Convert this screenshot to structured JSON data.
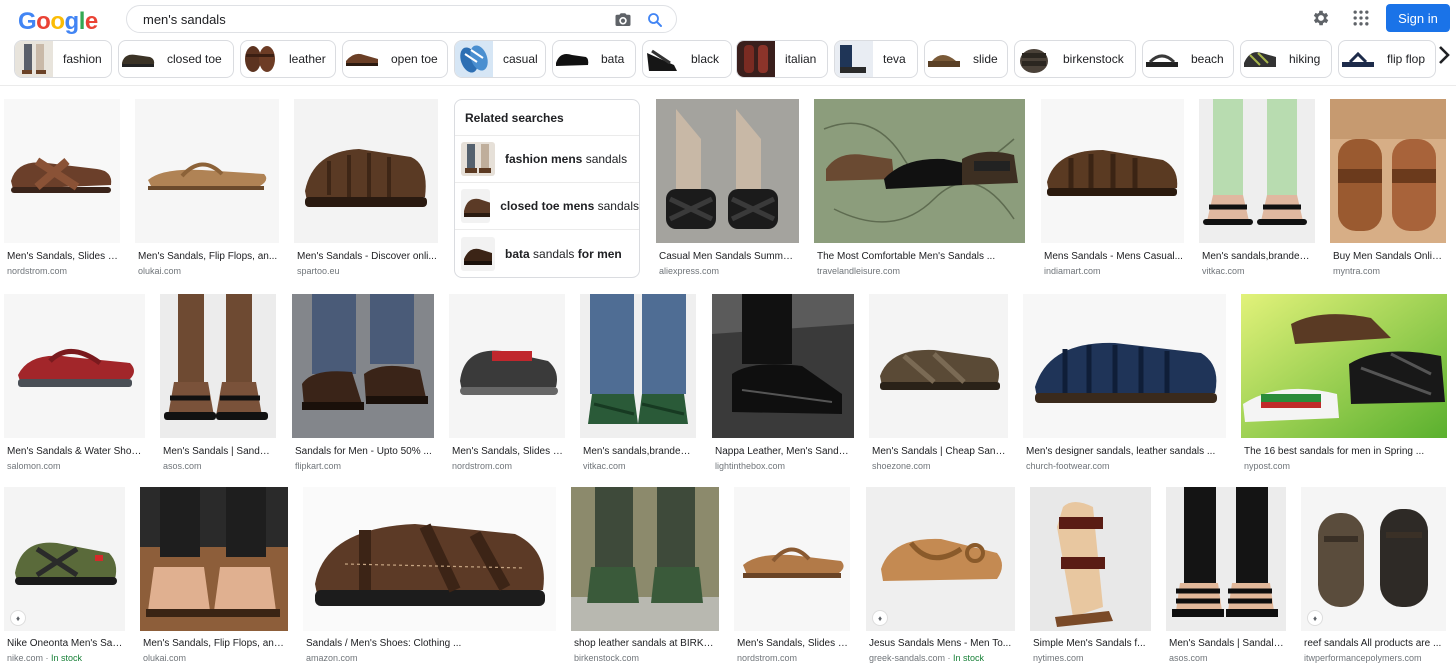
{
  "logo": [
    "G",
    "o",
    "o",
    "g",
    "l",
    "e"
  ],
  "search": {
    "query": "men's sandals"
  },
  "header": {
    "signin_label": "Sign in"
  },
  "chips": [
    "fashion",
    "closed toe",
    "leather",
    "open toe",
    "casual",
    "bata",
    "black",
    "italian",
    "teva",
    "slide",
    "birkenstock",
    "beach",
    "hiking",
    "flip flop"
  ],
  "related": {
    "title": "Related searches",
    "items": [
      {
        "bold1": "fashion mens",
        "plain": "sandals",
        "bold2": ""
      },
      {
        "bold1": "closed toe mens",
        "plain": "sandals",
        "bold2": ""
      },
      {
        "bold1": "bata",
        "plain": "sandals",
        "bold2": "for men"
      }
    ]
  },
  "results": [
    {
      "title": "Men's Sandals, Slides & ...",
      "source": "nordstrom.com"
    },
    {
      "title": "Men's Sandals, Flip Flops, an...",
      "source": "olukai.com"
    },
    {
      "title": "Men's Sandals - Discover onli...",
      "source": "spartoo.eu"
    },
    {
      "title": "Casual Men Sandals Summer...",
      "source": "aliexpress.com"
    },
    {
      "title": "The Most Comfortable Men's Sandals ...",
      "source": "travelandleisure.com"
    },
    {
      "title": "Mens Sandals - Mens Casual...",
      "source": "indiamart.com"
    },
    {
      "title": "Men's sandals,branded ...",
      "source": "vitkac.com"
    },
    {
      "title": "Buy Men Sandals Online...",
      "source": "myntra.com"
    },
    {
      "title": "Men's Sandals & Water Shoe...",
      "source": "salomon.com"
    },
    {
      "title": "Men's Sandals | Sandal...",
      "source": "asos.com"
    },
    {
      "title": "Sandals for Men - Upto 50% ...",
      "source": "flipkart.com"
    },
    {
      "title": "Men's Sandals, Slides & ...",
      "source": "nordstrom.com"
    },
    {
      "title": "Men's sandals,branded ...",
      "source": "vitkac.com"
    },
    {
      "title": "Nappa Leather, Men's Sandal...",
      "source": "lightinthebox.com"
    },
    {
      "title": "Men's Sandals | Cheap Sand...",
      "source": "shoezone.com"
    },
    {
      "title": "Men's designer sandals, leather sandals ...",
      "source": "church-footwear.com"
    },
    {
      "title": "The 16 best sandals for men in Spring ...",
      "source": "nypost.com"
    },
    {
      "title": "Nike Oneonta Men's San...",
      "source": "nike.com",
      "stock": "In stock"
    },
    {
      "title": "Men's Sandals, Flip Flops, and ...",
      "source": "olukai.com"
    },
    {
      "title": "Sandals / Men's Shoes: Clothing ...",
      "source": "amazon.com"
    },
    {
      "title": "shop leather sandals at BIRKE...",
      "source": "birkenstock.com"
    },
    {
      "title": "Men's Sandals, Slides & ...",
      "source": "nordstrom.com"
    },
    {
      "title": "Jesus Sandals Mens - Men To...",
      "source": "greek-sandals.com",
      "stock": "In stock"
    },
    {
      "title": "Simple Men's Sandals f...",
      "source": "nytimes.com"
    },
    {
      "title": "Men's Sandals | Sandals...",
      "source": "asos.com"
    },
    {
      "title": "reef sandals All products are ...",
      "source": "itwperformancepolymers.com"
    }
  ],
  "colors": {
    "accent": "#1a73e8",
    "brown": "#7a4a30",
    "tan": "#b8865a"
  }
}
